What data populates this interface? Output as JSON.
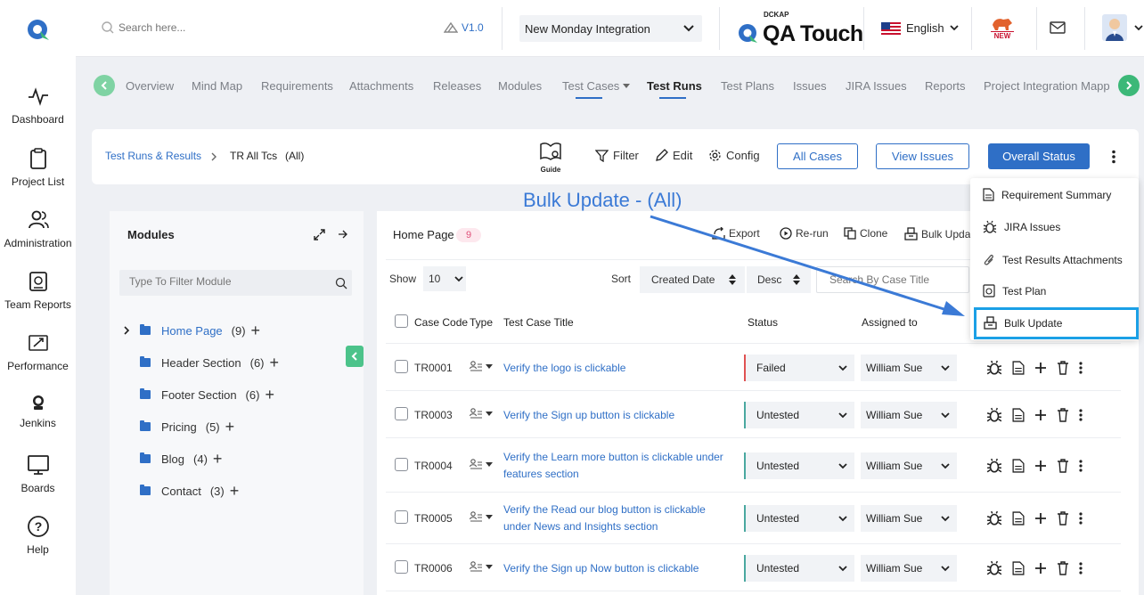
{
  "sidebar": {
    "items": [
      {
        "label": "Dashboard",
        "icon": "pulse-icon"
      },
      {
        "label": "Project List",
        "icon": "clipboard-icon"
      },
      {
        "label": "Administration",
        "icon": "users-icon"
      },
      {
        "label": "Team Reports",
        "icon": "team-reports-icon"
      },
      {
        "label": "Performance",
        "icon": "rocket-icon"
      },
      {
        "label": "Jenkins",
        "icon": "jenkins-icon"
      },
      {
        "label": "Boards",
        "icon": "board-icon"
      },
      {
        "label": "Help",
        "icon": "help-icon"
      }
    ]
  },
  "topbar": {
    "search_placeholder": "Search here...",
    "version": "V1.0",
    "project": "New Monday Integration",
    "brand_top": "DCKAP",
    "brand": "QA Touch",
    "language": "English",
    "new_badge": "NEW"
  },
  "nav": {
    "tabs": [
      "Overview",
      "Mind Map",
      "Requirements",
      "Attachments",
      "Releases",
      "Modules",
      "Test Cases",
      "Test Runs",
      "Test Plans",
      "Issues",
      "JIRA Issues",
      "Reports",
      "Project Integration Mappin"
    ],
    "active": "Test Runs"
  },
  "header": {
    "breadcrumb_link": "Test Runs & Results",
    "breadcrumb_current": "TR All Tcs",
    "breadcrumb_scope": "(All)",
    "guide": "Guide",
    "filter": "Filter",
    "edit": "Edit",
    "config": "Config",
    "all_cases": "All Cases",
    "view_issues": "View Issues",
    "overall_status": "Overall Status"
  },
  "annotation": "Bulk Update - (All)",
  "modules": {
    "title": "Modules",
    "filter_placeholder": "Type To Filter Module",
    "items": [
      {
        "name": "Home Page",
        "count": "(9)"
      },
      {
        "name": "Header Section",
        "count": "(6)"
      },
      {
        "name": "Footer Section",
        "count": "(6)"
      },
      {
        "name": "Pricing",
        "count": "(5)"
      },
      {
        "name": "Blog",
        "count": "(4)"
      },
      {
        "name": "Contact",
        "count": "(3)"
      }
    ]
  },
  "main": {
    "section": "Home Page",
    "count": "9",
    "export": "Export",
    "rerun": "Re-run",
    "clone": "Clone",
    "bulk": "Bulk Upda",
    "show_label": "Show",
    "show_value": "10",
    "sort_label": "Sort",
    "sort_field": "Created Date",
    "sort_dir": "Desc",
    "search_placeholder": "Search By Case Title",
    "columns": {
      "code": "Case Code",
      "type": "Type",
      "title": "Test Case Title",
      "status": "Status",
      "assigned": "Assigned to"
    },
    "rows": [
      {
        "code": "TR0001",
        "title": "Verify the logo is clickable",
        "title2": "",
        "status": "Failed",
        "assignee": "William Sue"
      },
      {
        "code": "TR0003",
        "title": "Verify the Sign up button is clickable",
        "title2": "",
        "status": "Untested",
        "assignee": "William Sue"
      },
      {
        "code": "TR0004",
        "title": "Verify the Learn more button is clickable under",
        "title2": "features section",
        "status": "Untested",
        "assignee": "William Sue"
      },
      {
        "code": "TR0005",
        "title": "Verify the Read our blog button is clickable",
        "title2": "under News and Insights section",
        "status": "Untested",
        "assignee": "William Sue"
      },
      {
        "code": "TR0006",
        "title": "Verify the Sign up Now button is clickable",
        "title2": "",
        "status": "Untested",
        "assignee": "William Sue"
      }
    ]
  },
  "dropdown": {
    "items": [
      "Requirement Summary",
      "JIRA Issues",
      "Test Results Attachments",
      "Test Plan",
      "Bulk Update"
    ],
    "highlighted": "Bulk Update"
  },
  "colors": {
    "accent": "#2f6fc6",
    "teal": "#4aa8a0",
    "failed": "#e05252",
    "nav_green": "#5cc08a"
  }
}
